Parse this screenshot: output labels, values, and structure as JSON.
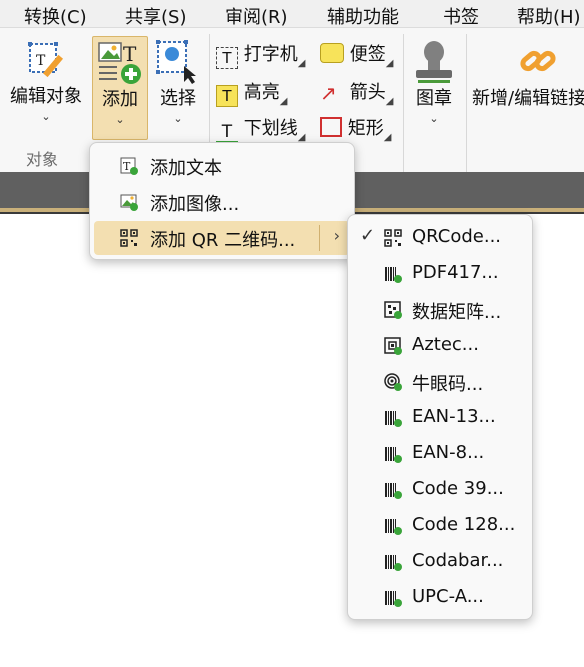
{
  "menubar": {
    "items": [
      "转换(C)",
      "共享(S)",
      "审阅(R)",
      "辅助功能",
      "书签",
      "帮助(H)"
    ]
  },
  "ribbon": {
    "edit_object": "编辑对象",
    "add": "添加",
    "select": "选择",
    "typewriter": "打字机",
    "highlight": "高亮",
    "underline": "下划线",
    "sticky_note": "便签",
    "arrow": "箭头",
    "rectangle": "矩形",
    "stamp": "图章",
    "new_edit_link": "新增/编辑链接",
    "group_objects": "对象"
  },
  "add_menu": {
    "items": [
      "添加文本",
      "添加图像...",
      "添加 QR 二维码..."
    ],
    "submenu_arrow": "›"
  },
  "qr_submenu": {
    "checkmark": "✓",
    "items": [
      "QRCode...",
      "PDF417...",
      "数据矩阵...",
      "Aztec...",
      "牛眼码...",
      "EAN-13...",
      "EAN-8...",
      "Code 39...",
      "Code 128...",
      "Codabar...",
      "UPC-A..."
    ]
  },
  "colors": {
    "highlight": "#f3dfb1",
    "toolbar_dark": "#606060",
    "accent_green": "#3aa43a",
    "accent_orange": "#f0a030"
  }
}
